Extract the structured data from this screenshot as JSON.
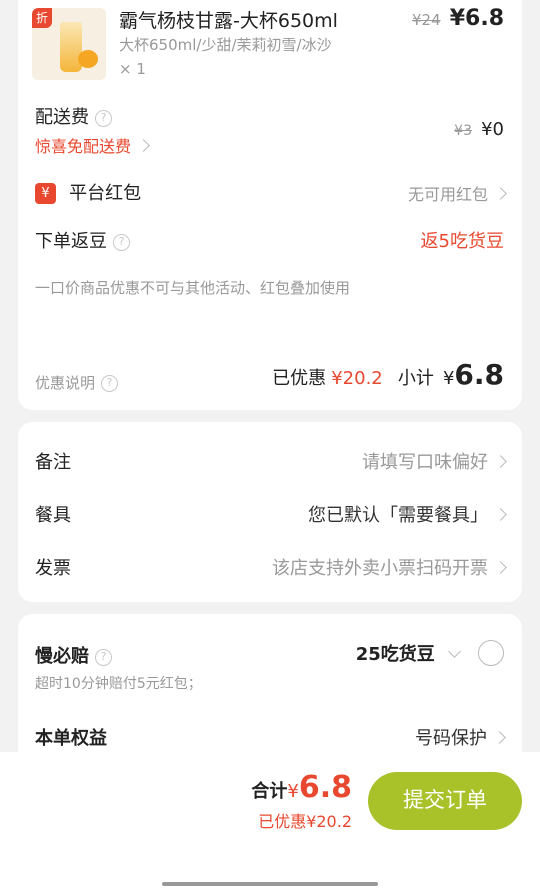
{
  "product": {
    "badge": "折",
    "name": "霸气杨枝甘露-大杯650ml",
    "specs": "大杯650ml/少甜/茉莉初雪/冰沙",
    "qty": "× 1",
    "orig_price": "¥24",
    "price": "¥6.8"
  },
  "delivery": {
    "label": "配送费",
    "promo": "惊喜免配送费",
    "orig_price": "¥3",
    "price": "¥0"
  },
  "platform_redpack": {
    "icon": "¥",
    "label": "平台红包",
    "value": "无可用红包"
  },
  "beans": {
    "label": "下单返豆",
    "value": "返5吃货豆"
  },
  "notice": "一口价商品优惠不可与其他活动、红包叠加使用",
  "summary": {
    "discount_label": "优惠说明",
    "saved_label": "已优惠",
    "saved_value": "¥20.2",
    "subtotal_label": "小计",
    "subtotal_currency": "¥",
    "subtotal_value": "6.8"
  },
  "options": [
    {
      "label": "备注",
      "value": "请填写口味偏好"
    },
    {
      "label": "餐具",
      "value": "您已默认「需要餐具」"
    },
    {
      "label": "发票",
      "value": "该店支持外卖小票扫码开票"
    }
  ],
  "guarantee": {
    "label": "慢必赔",
    "desc": "超时10分钟赔付5元红包；",
    "value": "25吃货豆"
  },
  "rights": {
    "label": "本单权益",
    "value": "号码保护"
  },
  "footer": {
    "total_label": "合计",
    "total_currency": "¥",
    "total_value": "6.8",
    "saved": "已优惠¥20.2",
    "submit": "提交订单"
  },
  "colors": {
    "accent_red": "#e8482f",
    "submit_green": "#a9c22a"
  }
}
